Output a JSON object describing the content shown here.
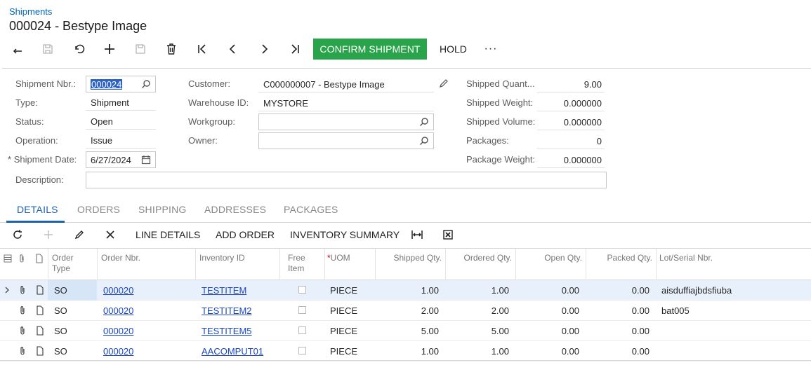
{
  "breadcrumb": "Shipments",
  "title": "000024 - Bestype Image",
  "toolbar": {
    "confirm_label": "CONFIRM SHIPMENT",
    "hold_label": "HOLD",
    "more_label": "···",
    "accent_color": "#2aa44b"
  },
  "form": {
    "shipment_nbr_label": "Shipment Nbr.:",
    "shipment_nbr": "000024",
    "type_label": "Type:",
    "type": "Shipment",
    "status_label": "Status:",
    "status": "Open",
    "operation_label": "Operation:",
    "operation": "Issue",
    "shipment_date_label": "Shipment Date:",
    "shipment_date": "6/27/2024",
    "description_label": "Description:",
    "description": "",
    "customer_label": "Customer:",
    "customer": "C000000007 - Bestype Image",
    "warehouse_label": "Warehouse ID:",
    "warehouse": "MYSTORE",
    "workgroup_label": "Workgroup:",
    "workgroup": "",
    "owner_label": "Owner:",
    "owner": "",
    "shipped_qty_label": "Shipped Quant...",
    "shipped_qty": "9.00",
    "shipped_weight_label": "Shipped Weight:",
    "shipped_weight": "0.000000",
    "shipped_volume_label": "Shipped Volume:",
    "shipped_volume": "0.000000",
    "packages_label": "Packages:",
    "packages": "0",
    "package_weight_label": "Package Weight:",
    "package_weight": "0.000000"
  },
  "tabs": [
    "DETAILS",
    "ORDERS",
    "SHIPPING",
    "ADDRESSES",
    "PACKAGES"
  ],
  "grid_toolbar": {
    "line_details": "LINE DETAILS",
    "add_order": "ADD ORDER",
    "inventory_summary": "INVENTORY SUMMARY"
  },
  "grid": {
    "headers": {
      "order_type": "Order\nType",
      "order_nbr": "Order Nbr.",
      "inventory_id": "Inventory ID",
      "free_item": "Free\nItem",
      "uom": "UOM",
      "shipped_qty": "Shipped Qty.",
      "ordered_qty": "Ordered Qty.",
      "open_qty": "Open Qty.",
      "packed_qty": "Packed Qty.",
      "lot_serial": "Lot/Serial Nbr."
    },
    "rows": [
      {
        "order_type": "SO",
        "order_nbr": "000020",
        "inventory_id": "TESTITEM",
        "uom": "PIECE",
        "shipped_qty": "1.00",
        "ordered_qty": "1.00",
        "open_qty": "0.00",
        "packed_qty": "0.00",
        "lot_serial": "aisduffiajbdsfiuba"
      },
      {
        "order_type": "SO",
        "order_nbr": "000020",
        "inventory_id": "TESTITEM2",
        "uom": "PIECE",
        "shipped_qty": "2.00",
        "ordered_qty": "2.00",
        "open_qty": "0.00",
        "packed_qty": "0.00",
        "lot_serial": "bat005"
      },
      {
        "order_type": "SO",
        "order_nbr": "000020",
        "inventory_id": "TESTITEM5",
        "uom": "PIECE",
        "shipped_qty": "5.00",
        "ordered_qty": "5.00",
        "open_qty": "0.00",
        "packed_qty": "0.00",
        "lot_serial": ""
      },
      {
        "order_type": "SO",
        "order_nbr": "000020",
        "inventory_id": "AACOMPUT01",
        "uom": "PIECE",
        "shipped_qty": "1.00",
        "ordered_qty": "1.00",
        "open_qty": "0.00",
        "packed_qty": "0.00",
        "lot_serial": ""
      }
    ]
  }
}
